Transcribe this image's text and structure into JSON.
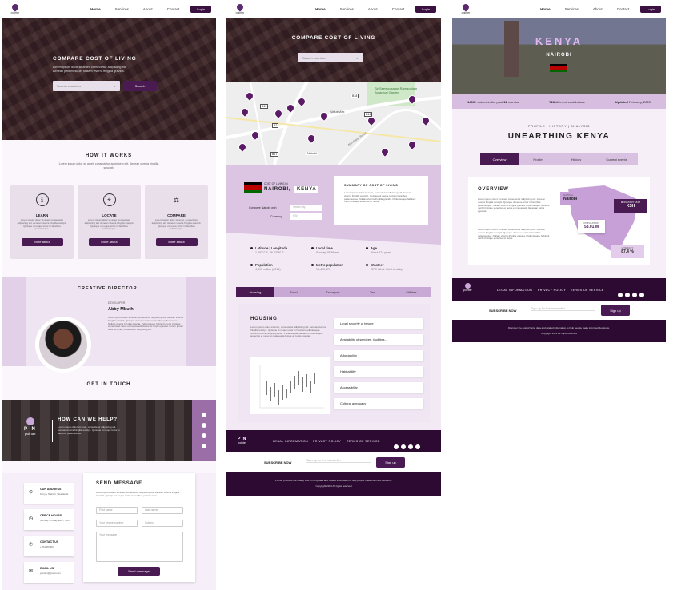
{
  "nav": {
    "logo": "pointer",
    "home": "Home",
    "services": "Services",
    "about": "About",
    "contact": "Contact",
    "login": "Login"
  },
  "p1": {
    "hero_title": "COMPARE COST OF LIVING",
    "hero_sub": "Lorem ipsum dolor sit amet, consectetur adipiscing elit. Aenean pellentesque. Nullam viverra fringilla gravida.",
    "search_placeholder": "Search countries",
    "search_btn": "Search",
    "how_title": "HOW IT WORKS",
    "how_sub": "Lorem ipsum dolor sit amet, consectetur adipiscing elit. Aenean viverra fringilla suscipit.",
    "cards": [
      {
        "title": "LEARN",
        "text": "Lorem ipsum dolor sit amet, consectetur adipiscing elit. Aenean viverra fringilla suscipit. Quisque ut neque tortor in faucibus pellentesque.",
        "btn": "More about"
      },
      {
        "title": "LOCATE",
        "text": "Lorem ipsum dolor sit amet, consectetur adipiscing elit. Aenean viverra fringilla suscipit. Quisque ut neque tortor in faucibus pellentesque.",
        "btn": "More about"
      },
      {
        "title": "COMPARE",
        "text": "Lorem ipsum dolor sit amet, consectetur adipiscing elit. Aenean viverra fringilla suscipit. Quisque ut neque tortor in faucibus pellentesque.",
        "btn": "More about"
      }
    ],
    "director_title": "CREATIVE DIRECTOR",
    "director_role": "DEVELOPER",
    "director_name": "Abby Mbuthi",
    "director_text": "Lorem ipsum dolor sit amet, consectetur adipiscing elit. Aenean viverra fringilla suscipit. Quisque ut neque tortor in faucibus pellentesque. Nullam viverra fringilla gravida. Pellentesque habitant morbi tristique senectus et netus et malesuada fames ac turpis egestas. Lorem ipsum dolor sit amet, consectetur adipiscing elit.",
    "touch_title": "GET IN TOUCH",
    "help_title": "HOW CAN WE HELP?",
    "help_text": "Lorem ipsum dolor sit amet, consectetur adipiscing elit. Aenean viverra fringilla suscipit. Quisque ut neque tortor in faucibus pellentesque.",
    "contact_items": [
      {
        "title": "OUR ADDRESS",
        "text": "Kenya, Nairobi, Westlands"
      },
      {
        "title": "OFFICE HOURS",
        "text": "Monday - Friday 9am - 5pm"
      },
      {
        "title": "CONTACT US",
        "text": "+254000000"
      },
      {
        "title": "EMAIL US",
        "text": "pointer@gmail.com"
      }
    ],
    "send_title": "SEND MESSAGE",
    "send_text": "Lorem ipsum dolor sit amet, consectetur adipiscing elit. Aenean viverra fringilla suscipit. Quisque ut neque tortor in faucibus pellentesque.",
    "ph_first": "First name",
    "ph_last": "Last name",
    "ph_phone": "Your phone number",
    "ph_subject": "Subject",
    "ph_msg": "Your message",
    "send_btn": "Send message"
  },
  "p2": {
    "hero_title": "COMPARE COST OF LIVING",
    "search_placeholder": "Search countries",
    "map_labels": [
      "Sir Seewoosagur Ramgoolam Botanical Garden",
      "ValueMax",
      "Nairobi",
      "Mombasa Road"
    ],
    "road_labels": [
      "B19",
      "B18",
      "B14",
      "A2",
      "B17"
    ],
    "col_label": "COST OF LIVING IN",
    "city": "NAIROBI,",
    "country": "KENYA",
    "compare_label": "Compare Nairobi with",
    "compare_value": "Select city",
    "currency_label": "Currency",
    "currency_value": "KSH",
    "summary_title": "SUMMARY OF COST OF LIVING",
    "summary_text": "Lorem ipsum dolor sit amet, consectetur adipiscing elit. Aenean viverra fringilla suscipit. Quisque ut neque tortor in faucibus pellentesque. Nullam viverra fringilla gravida. Pellentesque habitant morbi tristique senectus et netus.",
    "stats": [
      {
        "label": "Latitude | Longitude",
        "value": "1.2921° S, 36.8219° E"
      },
      {
        "label": "Local time",
        "value": "Sunday 18:36 am"
      },
      {
        "label": "Age",
        "value": "About 124 years"
      },
      {
        "label": "Population",
        "value": "4,397 million (2019)"
      },
      {
        "label": "Metro population",
        "value": "10,400,576"
      },
      {
        "label": "Weather",
        "value": "22°C Wind: 5kh Humidity"
      }
    ],
    "tabs": [
      "Housing",
      "Food",
      "Transport",
      "Tax",
      "Utilities"
    ],
    "housing_title": "HOUSING",
    "housing_text": "Lorem ipsum dolor sit amet, consectetur adipiscing elit. Aenean viverra fringilla suscipit. Quisque ut neque tortor in faucibus pellentesque. Nullam viverra fringilla gravida. Pellentesque habitant morbi tristique senectus et netus et malesuada fames ac turpis egestas.",
    "housing_items": [
      "Legal security of tenure",
      "Availability of services, facilities...",
      "Affordability",
      "Habitability",
      "Accessibility",
      "Cultural adequacy"
    ],
    "legal": "LEGAL INFORMATION",
    "privacy": "PRIVACY POLICY",
    "terms": "TERMS OF SERVICE",
    "subscribe": "SUBSCRIBE NOW",
    "sub_ph": "Sign up for the newsletter",
    "sub_btn": "Sign up",
    "disclaimer": "Pointer provides the quality cost of living data and related information to help people make informed decisions.",
    "copyright": "Copyright 2023 All rights reserved"
  },
  "p3": {
    "country": "KENYA",
    "city": "NAIROBI",
    "entries": "1400+",
    "entries_text": "entries in the past",
    "months": "12",
    "months_text": "months",
    "contributors": "728",
    "contributors_text": "different contributors",
    "updated": "Updated",
    "updated_text": "February, 2023",
    "breadcrumb": "PROFILE | HISTORY | ANALYSIS",
    "title": "UNEARTHING KENYA",
    "tabs": [
      "Overview",
      "Profile",
      "History",
      "Current events"
    ],
    "overview_title": "OVERVIEW",
    "overview_text": "Lorem ipsum dolor sit amet, consectetur adipiscing elit. Aenean viverra fringilla suscipit. Quisque ut neque tortor in faucibus pellentesque. Nullam viverra fringilla gravida. Pellentesque habitant morbi tristique senectus et netus et malesuada fames ac turpis egestas.",
    "overview_text2": "Lorem ipsum dolor sit amet, consectetur adipiscing elit. Aenean viverra fringilla suscipit. Quisque ut neque tortor in faucibus pellentesque. Nullam viverra fringilla gravida. Pellentesque habitant morbi tristique senectus et netus.",
    "capital_label": "CAPITAL",
    "capital": "Nairobi",
    "currency_label": "MONETARY UNIT",
    "currency": "KSH",
    "population_label": "POPULATION",
    "population": "53.01 M",
    "literacy_label": "LITERACY",
    "literacy": "87.4 %",
    "legal": "LEGAL INFORMATION",
    "privacy": "PRIVACY POLICY",
    "terms": "TERMS OF SERVICE",
    "subscribe": "SUBSCRIBE NOW",
    "sub_ph": "Sign up for the newsletter",
    "sub_btn": "Sign up",
    "disclaimer": "Discover the cost of living data and related information to help people make informed decisions.",
    "copyright": "Copyright 2023 All rights reserved"
  },
  "colors": {
    "primary": "#3b1142",
    "accent": "#c6a0d4",
    "light": "#f3e9f5"
  }
}
